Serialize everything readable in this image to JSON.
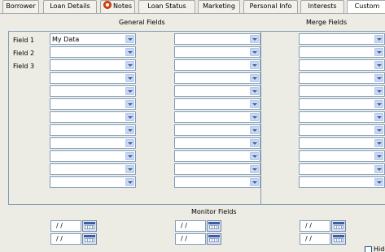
{
  "tabs": [
    {
      "label": "Borrower"
    },
    {
      "label": "Loan Details"
    },
    {
      "label": "Notes"
    },
    {
      "label": "Loan Status"
    },
    {
      "label": "Marketing"
    },
    {
      "label": "Personal Info"
    },
    {
      "label": "Interests"
    },
    {
      "label": "Custom"
    }
  ],
  "general": {
    "title": "General Fields",
    "labels": [
      "Field 1",
      "Field 2",
      "Field 3"
    ],
    "column1_values": [
      "My Data",
      "",
      "",
      "",
      "",
      "",
      "",
      "",
      "",
      "",
      "",
      ""
    ],
    "column2_values": [
      "",
      "",
      "",
      "",
      "",
      "",
      "",
      "",
      "",
      "",
      "",
      ""
    ]
  },
  "merge": {
    "title": "Merge Fields",
    "values": [
      "",
      "",
      "",
      "",
      "",
      "",
      "",
      "",
      "",
      "",
      "",
      ""
    ]
  },
  "monitor": {
    "title": "Monitor Fields",
    "date_values": [
      "/ /",
      "/ /",
      "/ /",
      "/ /",
      "/ /",
      "/ /"
    ]
  },
  "hide_checkbox": {
    "label": "Hide",
    "checked": false
  },
  "colors": {
    "border": "#7f9db9",
    "background": "#ecebe4",
    "notes_icon": "#e8400c"
  }
}
